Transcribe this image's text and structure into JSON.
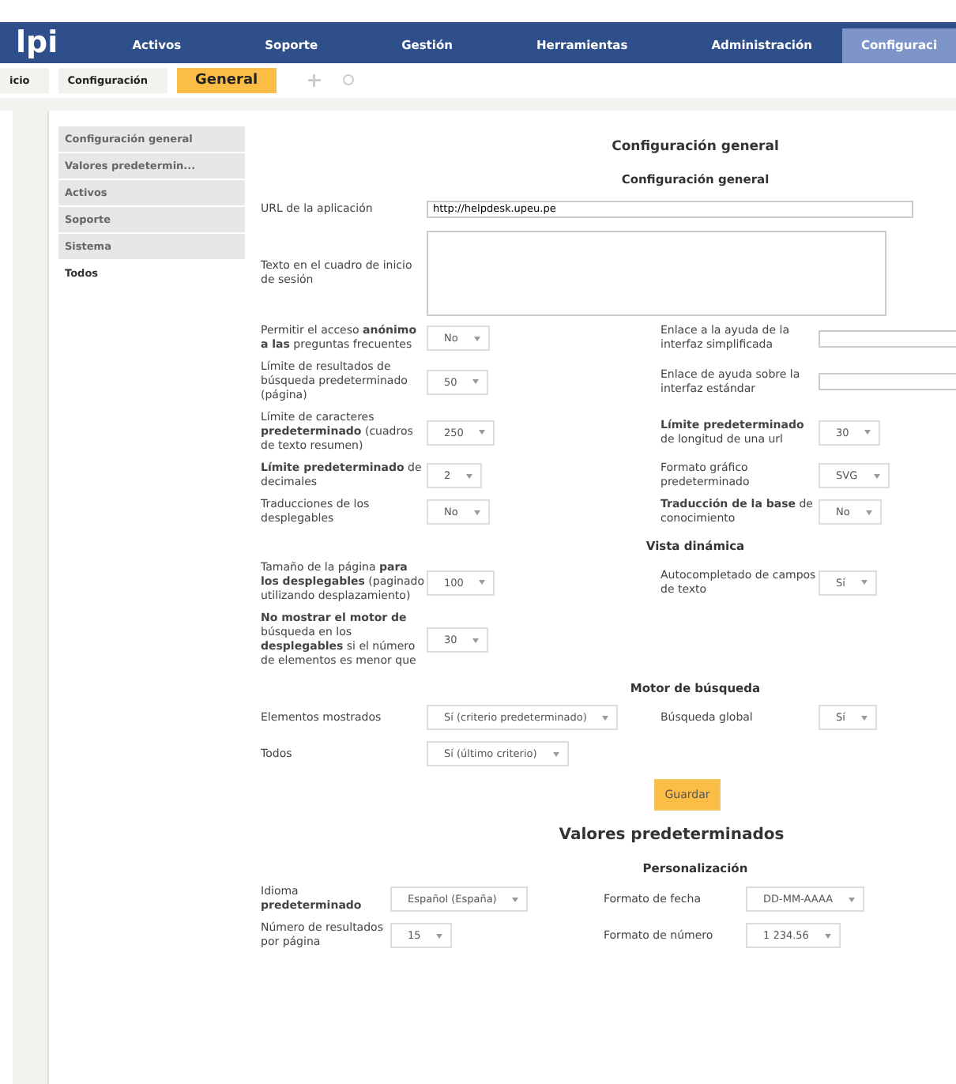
{
  "top_nav": {
    "logo": "lpi",
    "items": [
      {
        "label": "Activos",
        "selected": false
      },
      {
        "label": "Soporte",
        "selected": false
      },
      {
        "label": "Gestión",
        "selected": false
      },
      {
        "label": "Herramientas",
        "selected": false
      },
      {
        "label": "Administración",
        "selected": false
      },
      {
        "label": "Configuraci",
        "selected": true
      }
    ]
  },
  "breadcrumb": {
    "items": [
      "icio",
      "Configuración"
    ],
    "current": "General"
  },
  "sidebar": {
    "items": [
      {
        "label": "Configuración general",
        "selected": false
      },
      {
        "label": "Valores predetermin...",
        "selected": false
      },
      {
        "label": "Activos",
        "selected": false
      },
      {
        "label": "Soporte",
        "selected": false
      },
      {
        "label": "Sistema",
        "selected": false
      },
      {
        "label": "Todos",
        "selected": true
      }
    ]
  },
  "form": {
    "title": "Configuración general",
    "sections": [
      {
        "heading": "Configuración general",
        "rows": [
          {
            "fields": [
              {
                "label": "URL de la aplicación",
                "kind": "text",
                "value": "http://helpdesk.upeu.pe"
              }
            ]
          },
          {
            "fields": [
              {
                "label": "Texto en el cuadro de inicio de sesión",
                "kind": "textarea"
              }
            ]
          },
          {
            "fields": [
              {
                "label": "Permitir el acceso **anónimo a las** preguntas frecuentes",
                "kind": "select",
                "value": "No"
              },
              {
                "label": "Enlace a la ayuda de la interfaz simplificada",
                "kind": "text"
              }
            ]
          },
          {
            "fields": [
              {
                "label": "Límite de resultados de búsqueda predeterminado (página)",
                "kind": "select",
                "value": "50"
              },
              {
                "label": "Enlace de ayuda sobre la interfaz estándar",
                "kind": "text"
              }
            ]
          },
          {
            "fields": [
              {
                "label": "Límite de caracteres **predeterminado** (cuadros de texto resumen)",
                "kind": "select",
                "value": "250"
              },
              {
                "label": "**Límite predeterminado** de longitud de una url",
                "kind": "select",
                "value": "30"
              }
            ]
          },
          {
            "fields": [
              {
                "label": "**Límite predeterminado** de decimales",
                "kind": "select",
                "value": "2"
              },
              {
                "label": "Formato gráfico predeterminado",
                "kind": "select",
                "value": "SVG"
              }
            ]
          },
          {
            "fields": [
              {
                "label": "Traducciones de los desplegables",
                "kind": "select",
                "value": "No"
              },
              {
                "label": "**Traducción de la base** de conocimiento",
                "kind": "select",
                "value": "No"
              }
            ]
          }
        ]
      },
      {
        "heading": "Vista dinámica",
        "rows": [
          {
            "fields": [
              {
                "label": "Tamaño de la página **para los desplegables** (paginado utilizando desplazamiento)",
                "kind": "select",
                "value": "100"
              },
              {
                "label": "Autocompletado de campos de texto",
                "kind": "select",
                "value": "Sí"
              }
            ]
          },
          {
            "fields": [
              {
                "label": "**No mostrar el motor de** búsqueda en los **desplegables** si el número de elementos es menor que",
                "kind": "select",
                "value": "30"
              }
            ]
          }
        ]
      },
      {
        "heading": "Motor de búsqueda",
        "rows": [
          {
            "fields": [
              {
                "label": "Elementos mostrados",
                "kind": "select",
                "value": "Sí (criterio predeterminado)"
              },
              {
                "label": "Búsqueda global",
                "kind": "select",
                "value": "Sí"
              }
            ]
          },
          {
            "fields": [
              {
                "label": "Todos",
                "kind": "select",
                "value": "Sí (último criterio)"
              }
            ]
          }
        ]
      }
    ],
    "save_button": "Guardar"
  },
  "defaults": {
    "title": "Valores predeterminados",
    "sections": [
      {
        "heading": "Personalización",
        "rows": [
          {
            "fields": [
              {
                "label": "Idioma **predeterminado**",
                "kind": "select",
                "value": "Español (España)"
              },
              {
                "label": "Formato de fecha",
                "kind": "select",
                "value": "DD-MM-AAAA"
              }
            ]
          },
          {
            "fields": [
              {
                "label": "Número de resultados por página",
                "kind": "select",
                "value": "15"
              },
              {
                "label": "Formato de número",
                "kind": "select",
                "value": "1 234.56"
              }
            ]
          }
        ]
      }
    ]
  }
}
